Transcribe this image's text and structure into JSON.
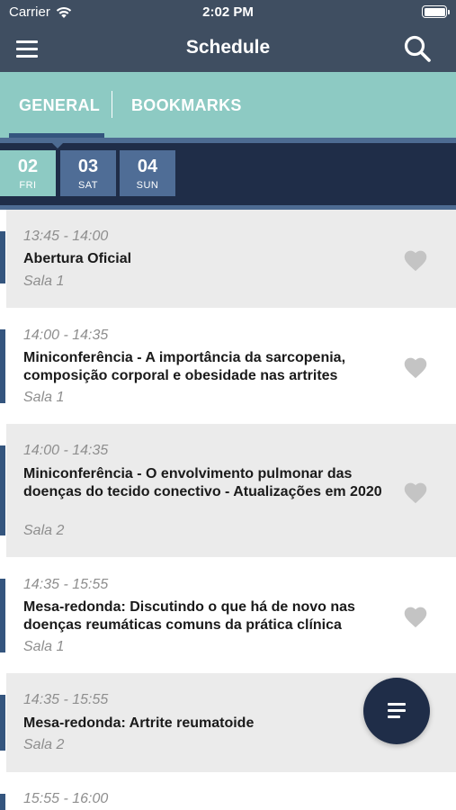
{
  "status_bar": {
    "carrier": "Carrier",
    "time": "2:02 PM"
  },
  "nav": {
    "title": "Schedule",
    "menu_icon": "hamburger-menu-icon",
    "search_icon": "search-icon"
  },
  "tabs": [
    {
      "label": "GENERAL",
      "active": true
    },
    {
      "label": "BOOKMARKS",
      "active": false
    }
  ],
  "days": [
    {
      "num": "02",
      "dow": "FRI",
      "selected": true
    },
    {
      "num": "03",
      "dow": "SAT",
      "selected": false
    },
    {
      "num": "04",
      "dow": "SUN",
      "selected": false
    }
  ],
  "sessions": [
    {
      "time": "13:45 - 14:00",
      "title": "Abertura Oficial",
      "room": "Sala 1",
      "bookmarked": false
    },
    {
      "time": "14:00 - 14:35",
      "title": "Miniconferência - A importância da sarcopenia, composição corporal e obesidade nas artrites",
      "room": "Sala 1",
      "bookmarked": false
    },
    {
      "time": "14:00 - 14:35",
      "title": "Miniconferência - O envolvimento pulmonar das doenças do tecido conectivo - Atualizações em 2020",
      "room": "Sala 2",
      "bookmarked": false
    },
    {
      "time": "14:35 - 15:55",
      "title": "Mesa-redonda: Discutindo o que há de novo nas doenças reumáticas comuns da prática clínica",
      "room": "Sala 1",
      "bookmarked": false
    },
    {
      "time": "14:35 - 15:55",
      "title": "Mesa-redonda: Artrite reumatoide",
      "room": "Sala 2",
      "bookmarked": false
    },
    {
      "time": "15:55 - 16:00",
      "title": "",
      "room": "",
      "bookmarked": false
    }
  ],
  "colors": {
    "header": "#3f4e61",
    "tabs_bg": "#8dcac3",
    "date_band": "#1f2d48",
    "accent": "#34557e",
    "day_tile": "#4f6d96",
    "row_grey": "#ebebeb",
    "heart": "#c4c4c4"
  },
  "fab_icon": "filter-list-icon"
}
